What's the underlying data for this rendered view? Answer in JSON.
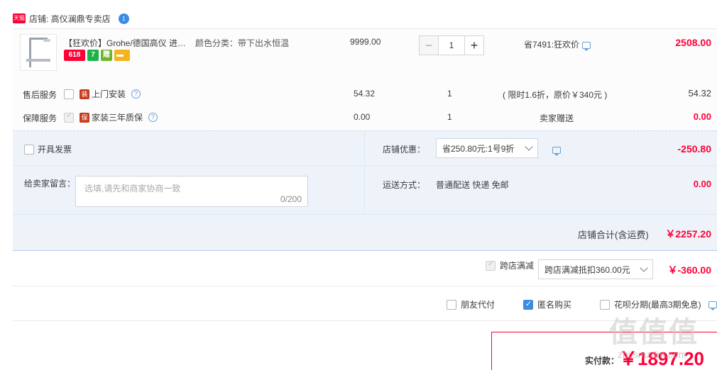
{
  "store": {
    "logo_text": "天猫",
    "label": "店铺: 高仪澜鼎专卖店",
    "ww_badge": "1"
  },
  "item": {
    "title": "【狂欢价】Grohe/德国高仪 进口淋浴花洒",
    "badges": [
      "618",
      "7",
      "赠",
      "▬"
    ],
    "sku": "颜色分类：带下出水恒温",
    "price": "9999.00",
    "qty_minus": "−",
    "qty": "1",
    "qty_plus": "+",
    "promo": "省7491:狂欢价",
    "subtotal": "2508.00"
  },
  "services": [
    {
      "label": "售后服务",
      "name": "上门安装",
      "icon": "装",
      "price": "54.32",
      "qty": "1",
      "note": "( 限时1.6折，原价￥340元 )",
      "subtotal": "54.32",
      "checked": false
    },
    {
      "label": "保障服务",
      "name": "家装三年质保",
      "icon": "保",
      "price": "0.00",
      "qty": "1",
      "note": "卖家赠送",
      "subtotal": "0.00",
      "checked": true
    }
  ],
  "order": {
    "invoice_label": "开具发票",
    "message_label": "给卖家留言：",
    "message_placeholder": "选填,请先和商家协商一致",
    "message_count": "0/200",
    "store_discount_label": "店铺优惠：",
    "store_discount_select": "省250.80元:1号9折",
    "store_discount_value": "-250.80",
    "shipping_label": "运送方式：",
    "shipping_value": "普通配送 快递 免邮",
    "shipping_fee": "0.00",
    "store_total_label": "店铺合计(含运费)",
    "store_total_value": "￥2257.20"
  },
  "cross_store": {
    "label": "跨店满减",
    "select": "跨店满减抵扣360.00元",
    "value": "￥-360.00"
  },
  "options": {
    "friend_pay": "朋友代付",
    "anonymous": "匿名购买",
    "huabei": "花呗分期(最高3期免息)"
  },
  "payment": {
    "label": "实付款：",
    "value": "￥1897.20"
  },
  "watermark": {
    "text": "值值值",
    "url": "zhi.smzdm.com"
  },
  "colors": {
    "accent_red": "#ff0036",
    "panel_blue": "#eef3fa",
    "link_blue": "#3b8ce6"
  }
}
